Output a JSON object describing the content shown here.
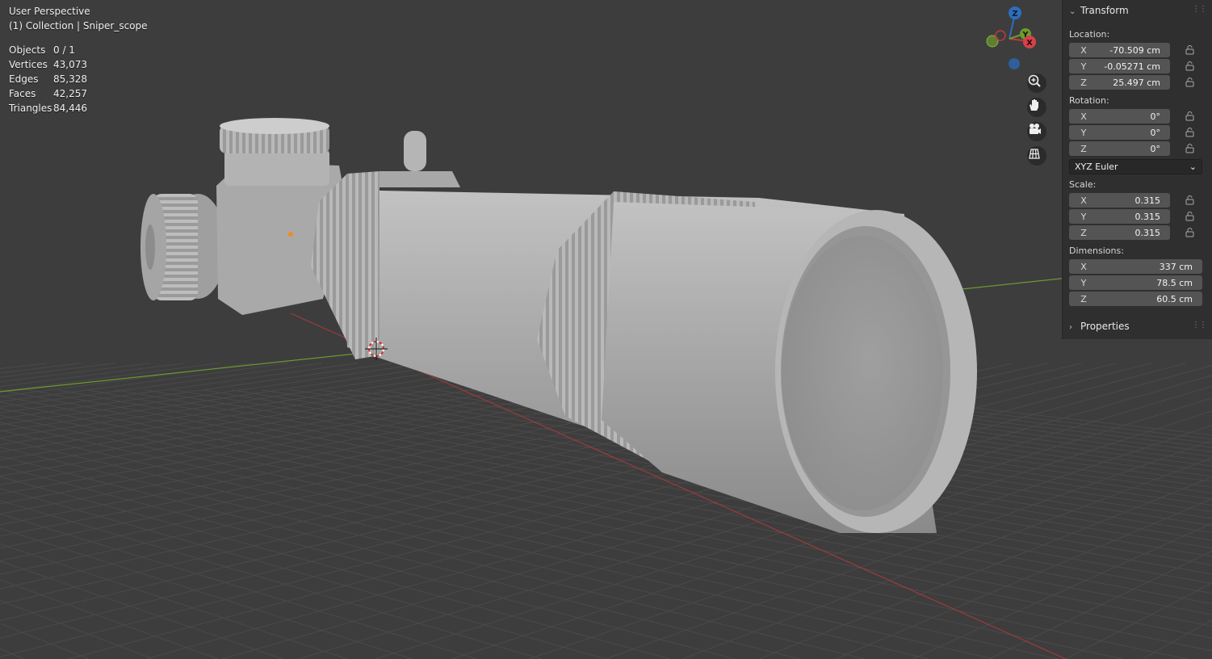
{
  "viewport": {
    "view_name": "User Perspective",
    "collection_label": "(1) Collection | Sniper_scope",
    "stats": [
      {
        "label": "Objects",
        "value": "0 / 1"
      },
      {
        "label": "Vertices",
        "value": "43,073"
      },
      {
        "label": "Edges",
        "value": "85,328"
      },
      {
        "label": "Faces",
        "value": "42,257"
      },
      {
        "label": "Triangles",
        "value": "84,446"
      }
    ],
    "gizmo": {
      "z": "Z",
      "y": "Y",
      "x": "X"
    },
    "nav_tools": [
      "zoom-icon",
      "pan-hand-icon",
      "camera-icon",
      "grid-ortho-icon"
    ],
    "colors": {
      "background": "#3d3d3d",
      "grid": "#4a4a4a",
      "x_axis": "#9c3b3b",
      "y_axis": "#6c9a2f",
      "model": "#a9a9a9"
    }
  },
  "npanel": {
    "transform_title": "Transform",
    "location_label": "Location:",
    "location": [
      {
        "axis": "X",
        "value": "-70.509 cm"
      },
      {
        "axis": "Y",
        "value": "-0.05271 cm"
      },
      {
        "axis": "Z",
        "value": "25.497 cm"
      }
    ],
    "rotation_label": "Rotation:",
    "rotation": [
      {
        "axis": "X",
        "value": "0°"
      },
      {
        "axis": "Y",
        "value": "0°"
      },
      {
        "axis": "Z",
        "value": "0°"
      }
    ],
    "rotation_mode": "XYZ Euler",
    "scale_label": "Scale:",
    "scale": [
      {
        "axis": "X",
        "value": "0.315"
      },
      {
        "axis": "Y",
        "value": "0.315"
      },
      {
        "axis": "Z",
        "value": "0.315"
      }
    ],
    "dimensions_label": "Dimensions:",
    "dimensions": [
      {
        "axis": "X",
        "value": "337 cm"
      },
      {
        "axis": "Y",
        "value": "78.5 cm"
      },
      {
        "axis": "Z",
        "value": "60.5 cm"
      }
    ],
    "properties_title": "Properties"
  }
}
